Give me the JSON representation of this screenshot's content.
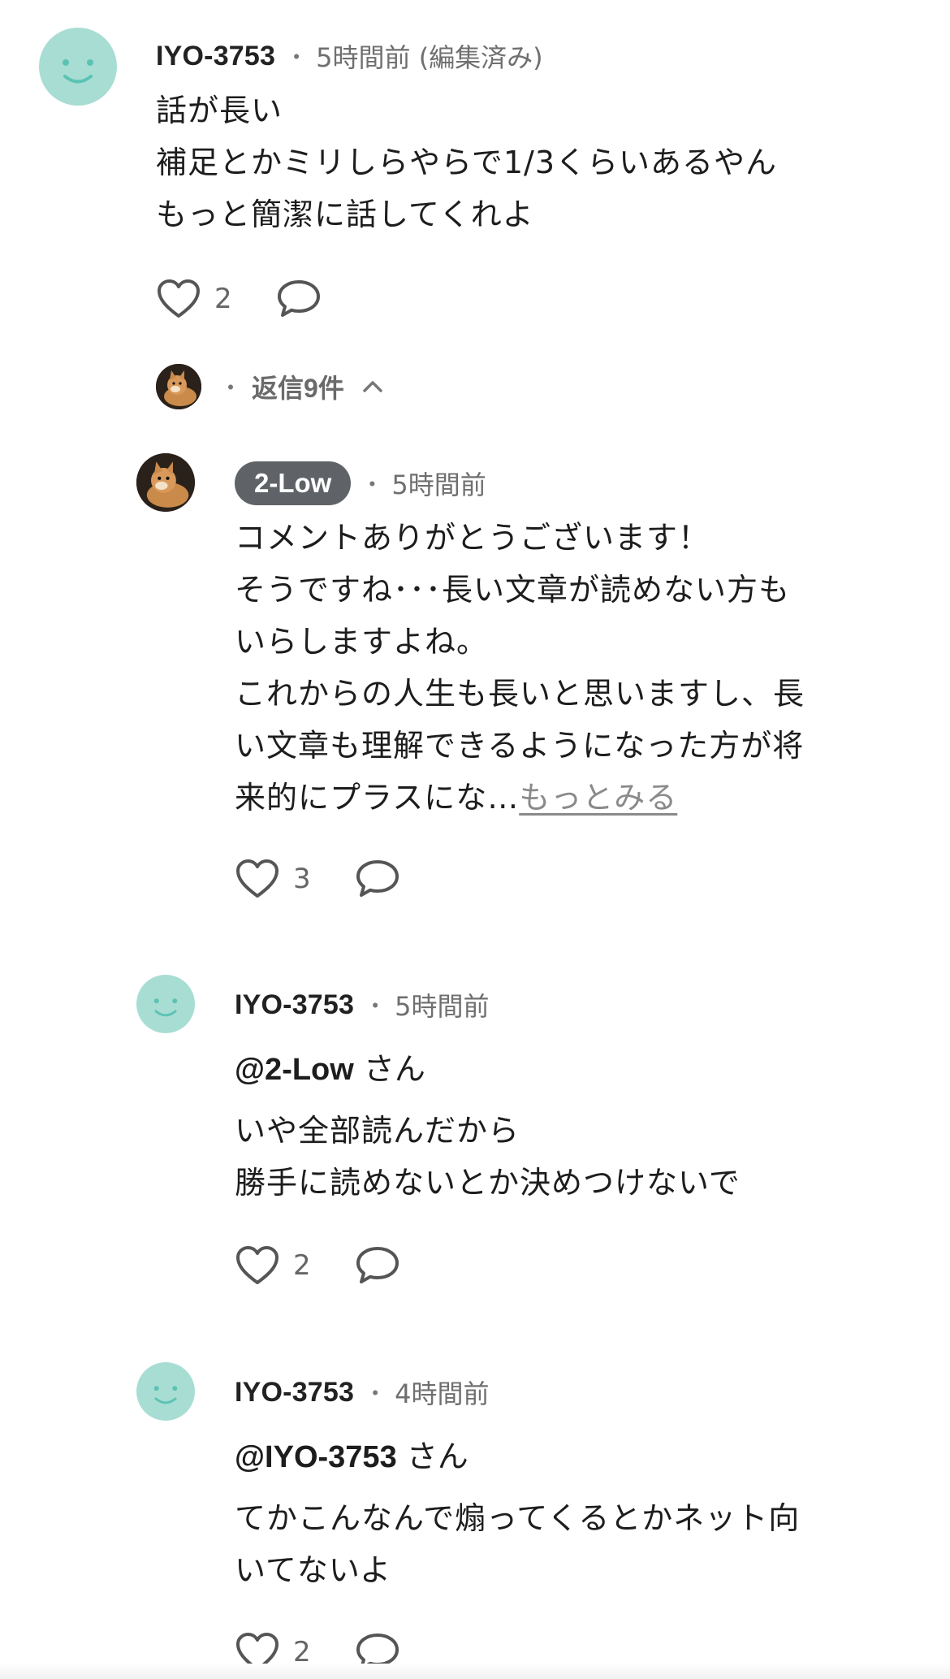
{
  "comment": {
    "username": "IYO-3753",
    "time": "5時間前 (編集済み)",
    "body": "話が長い\n補足とかミリしらやらで1/3くらいあるやん\nもっと簡潔に話してくれよ",
    "likes": "2",
    "avatar_icon": "smiley-avatar-icon"
  },
  "replies_toggle": {
    "label": "返信9件",
    "icon": "chevron-up-icon"
  },
  "replies": [
    {
      "username": "2-Low",
      "is_author": true,
      "time": "5時間前",
      "body": "コメントありがとうございます！\nそうですね･･･長い文章が読めない方も\nいらしますよね。\nこれからの人生も長いと思いますし、長\nい文章も理解できるようになった方が将\n来的にプラスにな…",
      "more_label": "もっとみる",
      "likes": "3",
      "avatar_icon": "shiba-dog-avatar-icon"
    },
    {
      "username": "IYO-3753",
      "time": "5時間前",
      "mention": "@2-Low",
      "mention_suffix": " さん",
      "body": "いや全部読んだから\n勝手に読めないとか決めつけないで",
      "likes": "2",
      "avatar_icon": "smiley-avatar-icon"
    },
    {
      "username": "IYO-3753",
      "time": "4時間前",
      "mention": "@IYO-3753",
      "mention_suffix": " さん",
      "body": "てかこんなんで煽ってくるとかネット向\nいてないよ",
      "likes": "2",
      "avatar_icon": "smiley-avatar-icon"
    }
  ],
  "separator": "・",
  "colors": {
    "avatar_bg": "#a8ddd4",
    "avatar_face": "#5cc3b4",
    "author_pill": "#5f6368",
    "icon_stroke": "#555555"
  }
}
